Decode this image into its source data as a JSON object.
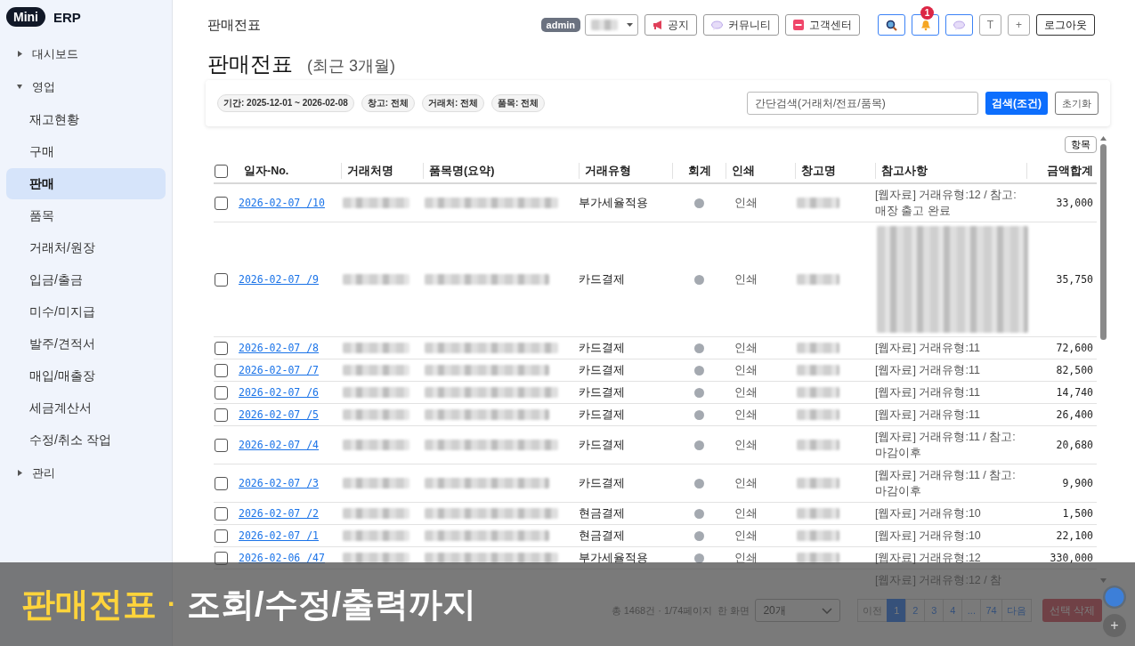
{
  "logo": {
    "badge": "Mini",
    "text": "ERP"
  },
  "sidebar": {
    "items": [
      {
        "label": "대시보드",
        "expanded": false
      },
      {
        "label": "영업",
        "expanded": true,
        "children": [
          {
            "label": "재고현황",
            "selected": false
          },
          {
            "label": "구매",
            "selected": false
          },
          {
            "label": "판매",
            "selected": true
          },
          {
            "label": "품목",
            "selected": false
          },
          {
            "label": "거래처/원장",
            "selected": false
          },
          {
            "label": "입금/출금",
            "selected": false
          },
          {
            "label": "미수/미지급",
            "selected": false
          },
          {
            "label": "발주/견적서",
            "selected": false
          },
          {
            "label": "매입/매출장",
            "selected": false
          },
          {
            "label": "세금계산서",
            "selected": false
          },
          {
            "label": "수정/취소 작업",
            "selected": false
          }
        ]
      },
      {
        "label": "관리",
        "expanded": false
      }
    ]
  },
  "header": {
    "breadcrumb": "판매전표",
    "user_badge": "admin",
    "buttons": [
      {
        "kind": "notice",
        "label": "공지"
      },
      {
        "kind": "community",
        "label": "커뮤니티"
      },
      {
        "kind": "support",
        "label": "고객센터"
      }
    ],
    "icon_buttons": [
      {
        "kind": "search"
      },
      {
        "kind": "bell",
        "badge": "1"
      },
      {
        "kind": "chat"
      },
      {
        "kind": "text",
        "label": "T"
      },
      {
        "kind": "text",
        "label": "+"
      }
    ],
    "logout": "로그아웃"
  },
  "page": {
    "title": "판매전표",
    "subtitle": "(최근 3개월)"
  },
  "filters": {
    "chips": [
      "기간: 2025-12-01 ~ 2026-02-08",
      "창고: 전체",
      "거래처: 전체",
      "품목: 전체"
    ],
    "search": {
      "placeholder": "간단검색(거래처/전표/품목)"
    },
    "search_button": "검색(조건)",
    "reset_button": "초기화"
  },
  "table": {
    "columns_button": "항목",
    "select_all_checked": false,
    "columns": [
      "일자-No.",
      "거래처명",
      "품목명(요약)",
      "거래유형",
      "회계",
      "인쇄",
      "창고명",
      "참고사항",
      "금액합계"
    ],
    "rows": [
      {
        "kind": "row",
        "checked": false,
        "date_no": "2026-02-07 /10",
        "type": "부가세율적용",
        "posted": false,
        "print": "인쇄",
        "note": "[웹자료] 거래유형:12 / 참고:매장 출고 완료",
        "note_blurred": false,
        "amount": "33,000"
      },
      {
        "kind": "row",
        "checked": false,
        "date_no": "2026-02-07 /9",
        "type": "카드결제",
        "posted": false,
        "print": "인쇄",
        "note_blurred": true,
        "amount": "35,750"
      },
      {
        "kind": "row",
        "checked": false,
        "date_no": "2026-02-07 /8",
        "type": "카드결제",
        "posted": false,
        "print": "인쇄",
        "note": "[웹자료] 거래유형:11",
        "note_blurred": false,
        "amount": "72,600"
      },
      {
        "kind": "row",
        "checked": false,
        "date_no": "2026-02-07 /7",
        "type": "카드결제",
        "posted": false,
        "print": "인쇄",
        "note": "[웹자료] 거래유형:11",
        "note_blurred": false,
        "amount": "82,500"
      },
      {
        "kind": "row",
        "checked": false,
        "date_no": "2026-02-07 /6",
        "type": "카드결제",
        "posted": false,
        "print": "인쇄",
        "note": "[웹자료] 거래유형:11",
        "note_blurred": false,
        "amount": "14,740"
      },
      {
        "kind": "row",
        "checked": false,
        "date_no": "2026-02-07 /5",
        "type": "카드결제",
        "posted": false,
        "print": "인쇄",
        "note": "[웹자료] 거래유형:11",
        "note_blurred": false,
        "amount": "26,400"
      },
      {
        "kind": "row",
        "checked": false,
        "date_no": "2026-02-07 /4",
        "type": "카드결제",
        "posted": false,
        "print": "인쇄",
        "note": "[웹자료] 거래유형:11 / 참고:마감이후",
        "note_blurred": false,
        "amount": "20,680"
      },
      {
        "kind": "row",
        "checked": false,
        "date_no": "2026-02-07 /3",
        "type": "카드결제",
        "posted": false,
        "print": "인쇄",
        "note": "[웹자료] 거래유형:11 / 참고:마감이후",
        "note_blurred": false,
        "amount": "9,900"
      },
      {
        "kind": "row",
        "checked": false,
        "date_no": "2026-02-07 /2",
        "type": "현금결제",
        "posted": false,
        "print": "인쇄",
        "note": "[웹자료] 거래유형:10",
        "note_blurred": false,
        "amount": "1,500"
      },
      {
        "kind": "row",
        "checked": false,
        "date_no": "2026-02-07 /1",
        "type": "현금결제",
        "posted": false,
        "print": "인쇄",
        "note": "[웹자료] 거래유형:10",
        "note_blurred": false,
        "amount": "22,100"
      },
      {
        "kind": "row",
        "checked": false,
        "date_no": "2026-02-06 /47",
        "type": "부가세율적용",
        "posted": false,
        "print": "인쇄",
        "note": "[웹자료] 거래유형:12",
        "note_blurred": false,
        "amount": "330,000"
      },
      {
        "kind": "partial",
        "note": "[웹자료] 거래유형:12 / 참"
      }
    ]
  },
  "pager": {
    "summary": "총 1468건 · 1/74페이지",
    "per_page_label": "한 화면",
    "per_page": "20개",
    "prev": "이전",
    "pages": [
      {
        "label": "1",
        "selected": true
      },
      {
        "label": "2",
        "selected": false
      },
      {
        "label": "3",
        "selected": false
      },
      {
        "label": "4",
        "selected": false
      },
      {
        "label": "...",
        "selected": false
      },
      {
        "label": "74",
        "selected": false
      }
    ],
    "next": "다음",
    "delete_button": "선택 삭제"
  },
  "fab": {
    "label": "+"
  },
  "caption": {
    "highlight": "판매전표",
    "separator": "·",
    "text": "조회/수정/출력까지"
  }
}
